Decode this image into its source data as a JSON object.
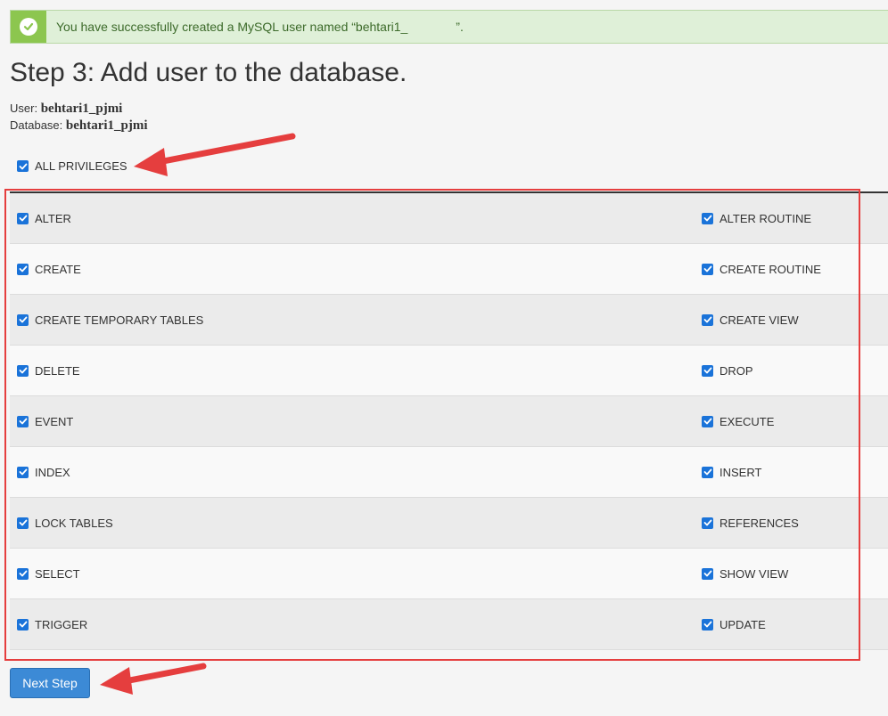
{
  "alert": {
    "message": "You have successfully created a MySQL user named “behtari1_",
    "message_end": "”.",
    "icon": "check-circle-icon",
    "color": "#8cc64f"
  },
  "heading": "Step 3: Add user to the database.",
  "user": {
    "label": "User:",
    "value": "behtari1_pjmi"
  },
  "database": {
    "label": "Database:",
    "value": "behtari1_pjmi"
  },
  "all_privileges": {
    "label": "ALL PRIVILEGES",
    "checked": true
  },
  "privileges": [
    {
      "left": "ALTER",
      "right": "ALTER ROUTINE"
    },
    {
      "left": "CREATE",
      "right": "CREATE ROUTINE"
    },
    {
      "left": "CREATE TEMPORARY TABLES",
      "right": "CREATE VIEW"
    },
    {
      "left": "DELETE",
      "right": "DROP"
    },
    {
      "left": "EVENT",
      "right": "EXECUTE"
    },
    {
      "left": "INDEX",
      "right": "INSERT"
    },
    {
      "left": "LOCK TABLES",
      "right": "REFERENCES"
    },
    {
      "left": "SELECT",
      "right": "SHOW VIEW"
    },
    {
      "left": "TRIGGER",
      "right": "UPDATE"
    }
  ],
  "next_button": "Next Step",
  "colors": {
    "checkbox": "#1a73d9",
    "annotation": "#e53e3e",
    "button": "#3c8ad6"
  }
}
